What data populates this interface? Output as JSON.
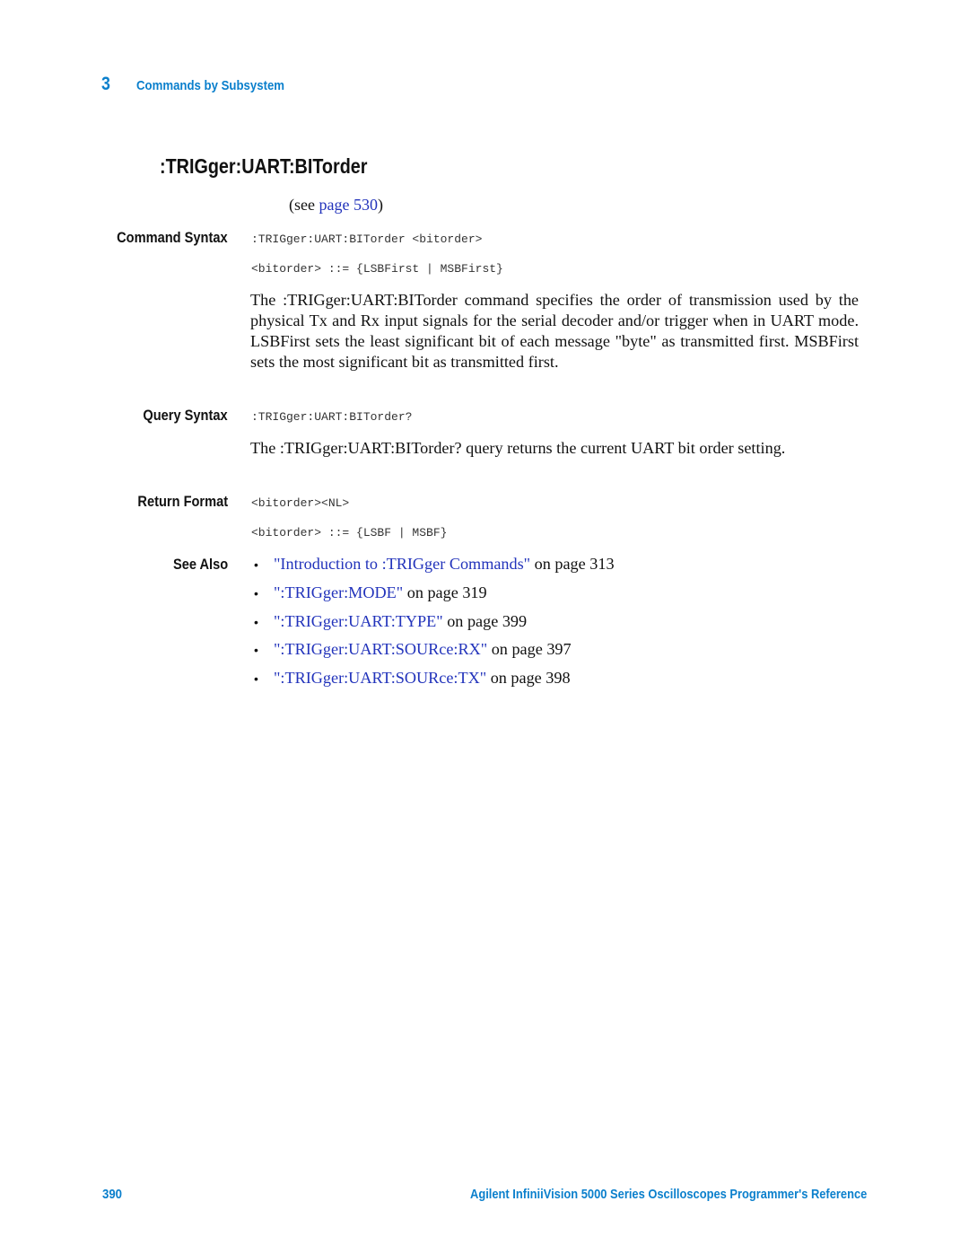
{
  "header": {
    "chapter_number": "3",
    "chapter_title": "Commands by Subsystem"
  },
  "section": {
    "title": ":TRIGger:UART:BITorder",
    "see_prefix": "(see ",
    "see_link": "page 530",
    "see_suffix": ")"
  },
  "command_syntax": {
    "label": "Command Syntax",
    "line1": ":TRIGger:UART:BITorder <bitorder>",
    "line2": "<bitorder> ::= {LSBFirst | MSBFirst}",
    "description": "The :TRIGger:UART:BITorder command specifies the order of transmission used by the physical Tx and Rx input signals for the serial decoder and/or trigger when in UART mode. LSBFirst sets the least significant bit of each message \"byte\" as transmitted first. MSBFirst sets the most significant bit as transmitted first."
  },
  "query_syntax": {
    "label": "Query Syntax",
    "line1": ":TRIGger:UART:BITorder?",
    "description": "The :TRIGger:UART:BITorder? query returns the current UART bit order setting."
  },
  "return_format": {
    "label": "Return Format",
    "line1": "<bitorder><NL>",
    "line2": "<bitorder> ::= {LSBF | MSBF}"
  },
  "see_also": {
    "label": "See Also",
    "bullet": "•",
    "items": [
      {
        "link": "\"Introduction to :TRIGger Commands\"",
        "suffix": " on page 313"
      },
      {
        "link": "\":TRIGger:MODE\"",
        "suffix": " on page 319"
      },
      {
        "link": "\":TRIGger:UART:TYPE\"",
        "suffix": " on page 399"
      },
      {
        "link": "\":TRIGger:UART:SOURce:RX\"",
        "suffix": " on page 397"
      },
      {
        "link": "\":TRIGger:UART:SOURce:TX\"",
        "suffix": " on page 398"
      }
    ]
  },
  "footer": {
    "page_number": "390",
    "book_title": "Agilent InfiniiVision 5000 Series Oscilloscopes Programmer's Reference"
  },
  "colors": {
    "accent_blue": "#0a7fcc",
    "link_blue": "#2233bb",
    "text": "#111111"
  }
}
